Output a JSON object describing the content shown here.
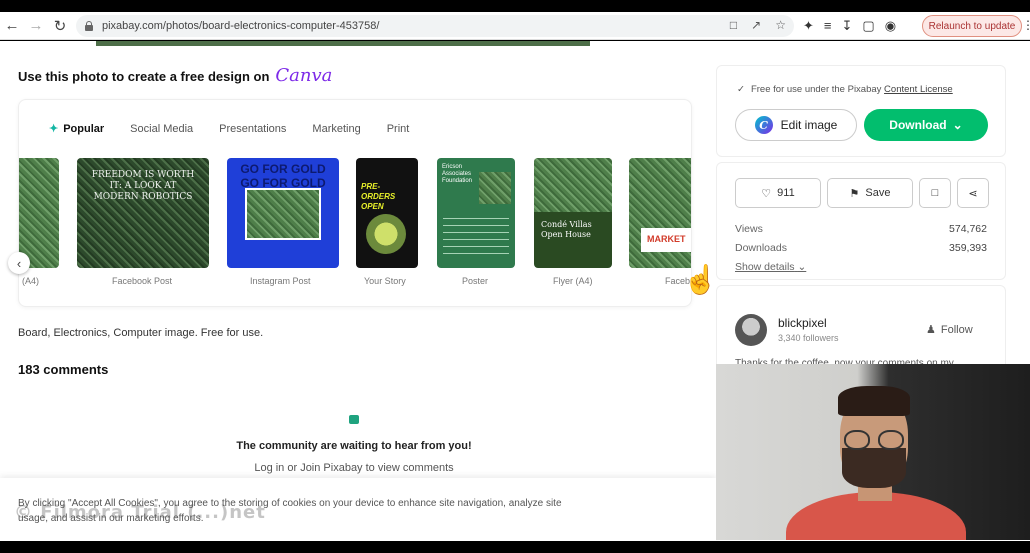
{
  "browser": {
    "url": "pixabay.com/photos/board-electronics-computer-453758/",
    "relaunch_label": "Relaunch to update"
  },
  "canva": {
    "heading": "Use this photo to create a free design on",
    "logo_text": "Canva",
    "tabs": [
      {
        "label": "Popular",
        "active": true
      },
      {
        "label": "Social Media"
      },
      {
        "label": "Presentations"
      },
      {
        "label": "Marketing"
      },
      {
        "label": "Print"
      }
    ],
    "templates": [
      {
        "label": "(A4)"
      },
      {
        "label": "Facebook Post",
        "text": "FREEDOM IS WORTH IT: A LOOK AT MODERN ROBOTICS"
      },
      {
        "label": "Instagram Post",
        "text": "GO FOR GOLD GO FOR GOLD"
      },
      {
        "label": "Your Story",
        "text": "PRE-ORDERS OPEN"
      },
      {
        "label": "Poster",
        "text": "Ericson Associates Foundation"
      },
      {
        "label": "Flyer (A4)",
        "text": "Condé Villas Open House"
      },
      {
        "label": "Faceb",
        "text": "MARKET"
      }
    ]
  },
  "caption": "Board, Electronics, Computer image. Free for use.",
  "comments": {
    "title": "183 comments",
    "empty_message": "The community are waiting to hear from you!",
    "login_text": "Log in or Join Pixabay to view comments"
  },
  "cookie": {
    "text": "By clicking \"Accept All Cookies\", you agree to the storing of cookies on your device to enhance site navigation, analyze site usage, and assist in our marketing efforts."
  },
  "watermark": "© Filmora Trial (...)net",
  "sidebar": {
    "license_prefix": "Free for use under the Pixabay",
    "license_link": "Content License",
    "edit_label": "Edit image",
    "download_label": "Download",
    "likes": "911",
    "save_label": "Save",
    "stats": [
      {
        "label": "Views",
        "value": "574,762"
      },
      {
        "label": "Downloads",
        "value": "359,393"
      }
    ],
    "show_details": "Show details",
    "author": {
      "name": "blickpixel",
      "followers": "3,340 followers",
      "follow_label": "Follow",
      "thanks": "Thanks for the coffee, now your comments on my"
    }
  },
  "colors": {
    "download_green": "#02be6e",
    "canva_purple": "#7d2ae8",
    "relaunch_bg": "#fce8e6"
  }
}
